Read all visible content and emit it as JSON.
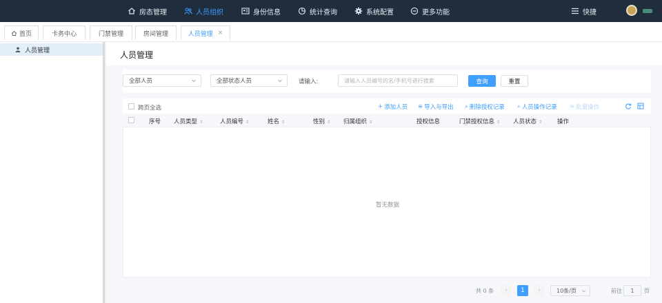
{
  "topnav": {
    "items": [
      {
        "label": "房态管理",
        "icon": "home-icon"
      },
      {
        "label": "人员组织",
        "icon": "users-icon",
        "active": true
      },
      {
        "label": "身份信息",
        "icon": "id-card-icon"
      },
      {
        "label": "统计查询",
        "icon": "pie-chart-icon"
      },
      {
        "label": "系统配置",
        "icon": "gear-icon"
      },
      {
        "label": "更多功能",
        "icon": "more-circle-icon"
      }
    ],
    "quick_label": "快捷"
  },
  "tabs": [
    {
      "label": "首页"
    },
    {
      "label": "卡务中心"
    },
    {
      "label": "门禁管理"
    },
    {
      "label": "房间管理"
    },
    {
      "label": "人员管理",
      "active": true,
      "close": "×"
    }
  ],
  "sidebar": {
    "items": [
      {
        "label": "人员管理",
        "active": true
      }
    ]
  },
  "page": {
    "title": "人员管理"
  },
  "filters": {
    "person_select": "全部人员",
    "status_select": "全部状态人员",
    "input_label": "请输入:",
    "input_placeholder": "请输入人员编号的名/手机号进行搜索",
    "query_button": "查询",
    "reset_button": "重置"
  },
  "table_toolbar": {
    "select_all_label": "跨页全选",
    "actions": [
      {
        "label": "添加人员",
        "icon": "+"
      },
      {
        "label": "导入与导出",
        "icon": "≡"
      },
      {
        "label": "删除授权记录",
        "icon": "⌕"
      },
      {
        "label": "人员操作记录",
        "icon": "⌕"
      },
      {
        "label": "批量操作",
        "icon": "≡",
        "disabled": true
      }
    ]
  },
  "table": {
    "columns": [
      "序号",
      "人员类型",
      "人员编号",
      "姓名",
      "性别",
      "归属组织",
      "授权信息",
      "门禁授权信息",
      "人员状态",
      "操作"
    ],
    "sortable": [
      false,
      true,
      true,
      true,
      true,
      true,
      false,
      true,
      true,
      false
    ],
    "rows": [],
    "empty_text": "暂无数据"
  },
  "pagination": {
    "total_text": "共 0 条",
    "current_page": "1",
    "page_size": "10条/页",
    "goto_label": "前往",
    "goto_value": "1",
    "page_suffix": "页",
    "prev": "‹",
    "next": "›"
  },
  "colors": {
    "topbar_bg": "#1f2d3d",
    "accent": "#409eff"
  }
}
